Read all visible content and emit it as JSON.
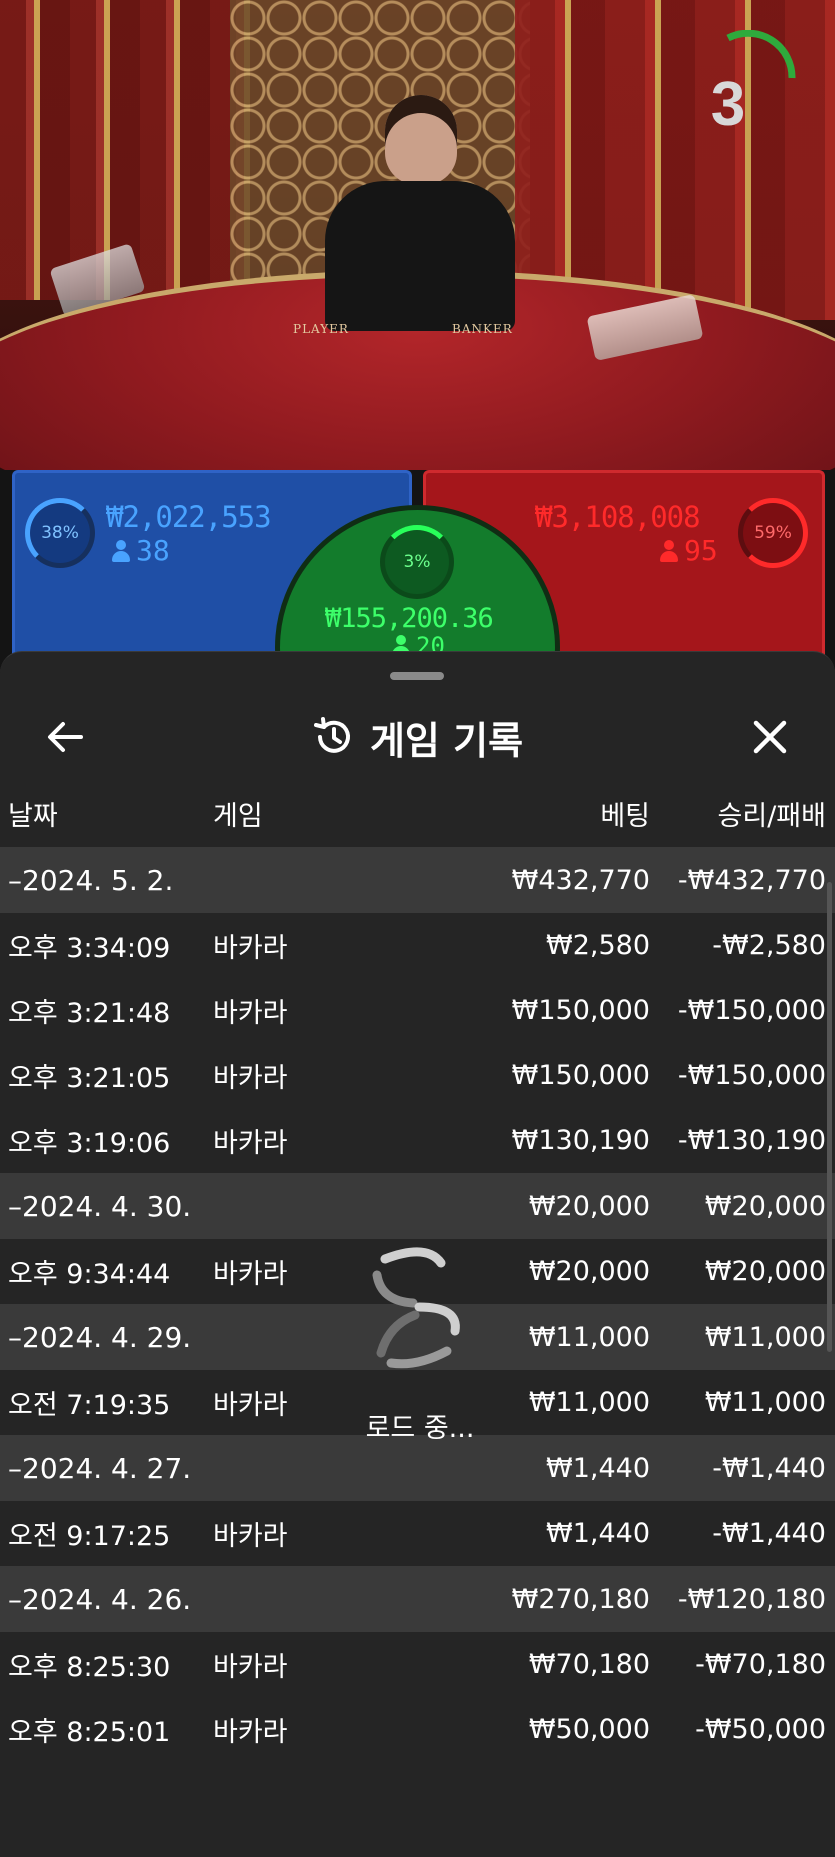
{
  "video": {
    "felt_player": "PLAYER",
    "felt_banker": "BANKER",
    "timer": "3"
  },
  "spots": {
    "player": {
      "pct": "38%",
      "amount": "₩2,022,553",
      "count": "38"
    },
    "banker": {
      "pct": "59%",
      "amount": "₩3,108,008",
      "count": "95"
    },
    "tie": {
      "pct": "3%",
      "amount": "₩155,200.36",
      "count": "20"
    }
  },
  "colors": {
    "player": "#49a3ff",
    "banker": "#ff2a2a",
    "tie": "#3dff6a",
    "sheet_bg": "#252525",
    "date_row_bg": "#3a3a3a"
  },
  "sheet": {
    "title": "게임 기록",
    "back_icon": "arrow-left-icon",
    "history_icon": "history-clock-icon",
    "close_icon": "close-icon",
    "columns": {
      "date": "날짜",
      "game": "게임",
      "bet": "베팅",
      "winloss": "승리/패배"
    },
    "rows": [
      {
        "type": "date",
        "date": "–2024. 5. 2.",
        "bet": "₩432,770",
        "win": "-₩432,770"
      },
      {
        "type": "game",
        "date": "오후 3:34:09",
        "game": "바카라",
        "bet": "₩2,580",
        "win": "-₩2,580"
      },
      {
        "type": "game",
        "date": "오후 3:21:48",
        "game": "바카라",
        "bet": "₩150,000",
        "win": "-₩150,000"
      },
      {
        "type": "game",
        "date": "오후 3:21:05",
        "game": "바카라",
        "bet": "₩150,000",
        "win": "-₩150,000"
      },
      {
        "type": "game",
        "date": "오후 3:19:06",
        "game": "바카라",
        "bet": "₩130,190",
        "win": "-₩130,190"
      },
      {
        "type": "date",
        "date": "–2024. 4. 30.",
        "bet": "₩20,000",
        "win": "₩20,000"
      },
      {
        "type": "game",
        "date": "오후 9:34:44",
        "game": "바카라",
        "bet": "₩20,000",
        "win": "₩20,000"
      },
      {
        "type": "date",
        "date": "–2024. 4. 29.",
        "bet": "₩11,000",
        "win": "₩11,000"
      },
      {
        "type": "game",
        "date": "오전 7:19:35",
        "game": "바카라",
        "bet": "₩11,000",
        "win": "₩11,000"
      },
      {
        "type": "date",
        "date": "–2024. 4. 27.",
        "bet": "₩1,440",
        "win": "-₩1,440"
      },
      {
        "type": "game",
        "date": "오전 9:17:25",
        "game": "바카라",
        "bet": "₩1,440",
        "win": "-₩1,440"
      },
      {
        "type": "date",
        "date": "–2024. 4. 26.",
        "bet": "₩270,180",
        "win": "-₩120,180"
      },
      {
        "type": "game",
        "date": "오후 8:25:30",
        "game": "바카라",
        "bet": "₩70,180",
        "win": "-₩70,180"
      },
      {
        "type": "game",
        "date": "오후 8:25:01",
        "game": "바카라",
        "bet": "₩50,000",
        "win": "-₩50,000"
      }
    ],
    "loading_text": "로드 중..."
  }
}
